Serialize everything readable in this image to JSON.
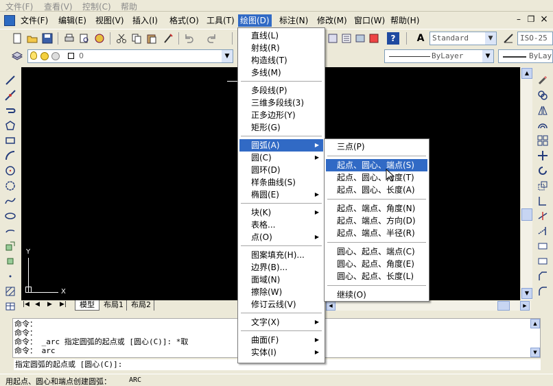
{
  "top_menu": [
    "文件(F)",
    "查看(V)",
    "控制(C)",
    "帮助"
  ],
  "menubar": {
    "items": [
      "文件(F)",
      "编辑(E)",
      "视图(V)",
      "插入(I)",
      "格式(O)",
      "工具(T)",
      "绘图(D)",
      "标注(N)",
      "修改(M)",
      "窗口(W)",
      "帮助(H)"
    ],
    "active": "绘图(D)"
  },
  "toolbar": {
    "text_style": "Standard",
    "dim_style": "ISO-25",
    "layer_value": "0",
    "linetype": "ByLayer",
    "lineweight": "ByLay"
  },
  "draw_menu": {
    "items": [
      {
        "label": "直线(L)"
      },
      {
        "label": "射线(R)"
      },
      {
        "label": "构造线(T)"
      },
      {
        "label": "多线(M)"
      },
      {
        "sep": true
      },
      {
        "label": "多段线(P)"
      },
      {
        "label": "三维多段线(3)"
      },
      {
        "label": "正多边形(Y)"
      },
      {
        "label": "矩形(G)"
      },
      {
        "sep": true
      },
      {
        "label": "圆弧(A)",
        "sub": true,
        "hl": true
      },
      {
        "label": "圆(C)",
        "sub": true
      },
      {
        "label": "圆环(D)"
      },
      {
        "label": "样条曲线(S)"
      },
      {
        "label": "椭圆(E)",
        "sub": true
      },
      {
        "sep": true
      },
      {
        "label": "块(K)",
        "sub": true
      },
      {
        "label": "表格..."
      },
      {
        "label": "点(O)",
        "sub": true
      },
      {
        "sep": true
      },
      {
        "label": "图案填充(H)..."
      },
      {
        "label": "边界(B)..."
      },
      {
        "label": "面域(N)"
      },
      {
        "label": "擦除(W)"
      },
      {
        "label": "修订云线(V)"
      },
      {
        "sep": true
      },
      {
        "label": "文字(X)",
        "sub": true
      },
      {
        "sep": true
      },
      {
        "label": "曲面(F)",
        "sub": true
      },
      {
        "label": "实体(I)",
        "sub": true
      }
    ]
  },
  "arc_submenu": {
    "items": [
      {
        "label": "三点(P)"
      },
      {
        "sep": true
      },
      {
        "label": "起点、圆心、端点(S)",
        "hl": true
      },
      {
        "label": "起点、圆心、角度(T)"
      },
      {
        "label": "起点、圆心、长度(A)"
      },
      {
        "sep": true
      },
      {
        "label": "起点、端点、角度(N)"
      },
      {
        "label": "起点、端点、方向(D)"
      },
      {
        "label": "起点、端点、半径(R)"
      },
      {
        "sep": true
      },
      {
        "label": "圆心、起点、端点(C)"
      },
      {
        "label": "圆心、起点、角度(E)"
      },
      {
        "label": "圆心、起点、长度(L)"
      },
      {
        "sep": true
      },
      {
        "label": "继续(O)"
      }
    ]
  },
  "layout_tabs": [
    "模型",
    "布局1",
    "布局2"
  ],
  "ucs": {
    "x": "X",
    "y": "Y"
  },
  "command_history": [
    "命令：",
    "命令：",
    "命令： _arc 指定圆弧的起点或 [圆心(C)]: *取",
    "命令： arc"
  ],
  "command_prompt": "指定圆弧的起点或 [圆心(C)]:",
  "status": {
    "text": "用起点、圆心和端点创建圆弧：",
    "command": "ARC"
  },
  "window_controls": {
    "minimize": "–",
    "restore": "❐",
    "close": "×"
  }
}
